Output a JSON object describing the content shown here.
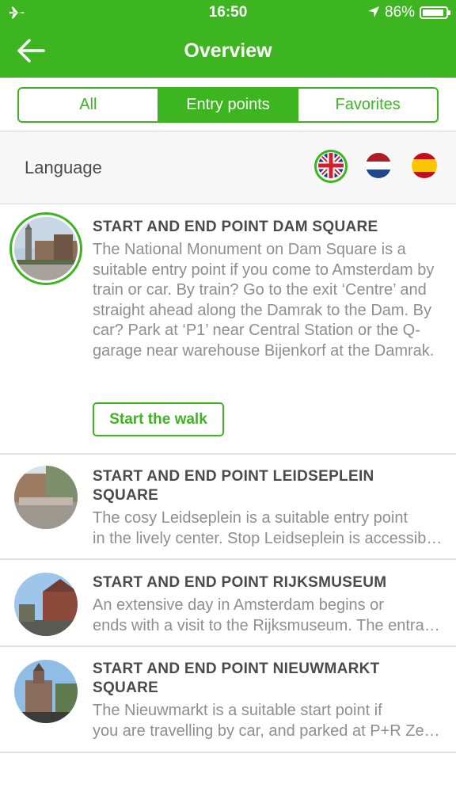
{
  "status": {
    "time": "16:50",
    "battery": "86%"
  },
  "header": {
    "title": "Overview"
  },
  "tabs": [
    {
      "label": "All",
      "active": false
    },
    {
      "label": "Entry points",
      "active": true
    },
    {
      "label": "Favorites",
      "active": false
    }
  ],
  "language": {
    "label": "Language",
    "flags": [
      "uk-flag-icon",
      "nl-flag-icon",
      "es-flag-icon"
    ],
    "selected": "uk-flag-icon"
  },
  "items": [
    {
      "title": "START AND END POINT DAM SQUARE",
      "desc": "The National Monument on Dam Square is a suitable entry point if you come to Amsterdam by train or car. By train? Go to the exit ‘Centre’ and straight ahead along the Damrak to the Dam. By car? Park at ‘P1’ near Central Station or the Q-garage near warehouse Bijenkorf at the Damrak.",
      "button": "Start the walk"
    },
    {
      "title_line1": "START AND END POINT LEIDSEPLEIN",
      "title_line2": "SQUARE",
      "desc_line1": "The cosy Leidseplein is a suitable entry point",
      "desc_line2": "in the lively center. Stop Leidseplein is accessible by tram."
    },
    {
      "title": "START AND END POINT RIJKSMUSEUM",
      "desc_line1": "An extensive day in Amsterdam begins or",
      "desc_line2": "ends with a visit to the Rijksmuseum. The entrance is at the Museumplein."
    },
    {
      "title_line1": "START AND END POINT NIEUWMARKT",
      "title_line2": "SQUARE",
      "desc_line1": "The Nieuwmarkt is a suitable start point if",
      "desc_line2": "you are travelling by car, and parked at P+R Zeeburg or Olympic Stadium."
    }
  ],
  "colors": {
    "brand": "#3cb521",
    "text": "#4a4a4a",
    "muted": "#8e8e8e"
  }
}
